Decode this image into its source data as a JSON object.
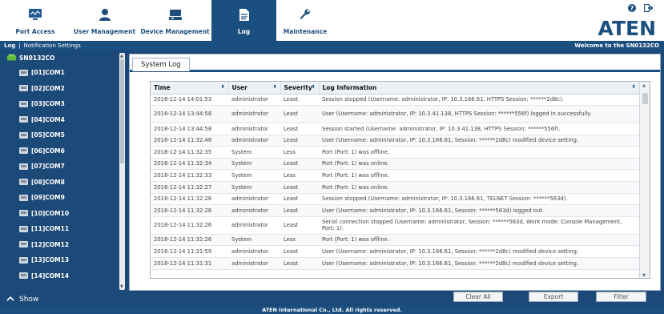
{
  "nav": {
    "tabs": [
      {
        "label": "Port Access",
        "icon": "port-access-icon"
      },
      {
        "label": "User Management",
        "icon": "user-icon"
      },
      {
        "label": "Device Management",
        "icon": "device-icon"
      },
      {
        "label": "Log",
        "icon": "log-icon",
        "active": true
      },
      {
        "label": "Maintenance",
        "icon": "wrench-icon"
      }
    ],
    "logo": "ATEN"
  },
  "subbar": {
    "crumb_log": "Log",
    "separator": "|",
    "crumb_notification": "Notification Settings",
    "welcome": "Welcome to the SN0132CO"
  },
  "sidebar": {
    "root": "SN0132CO",
    "items": [
      "[01]COM1",
      "[02]COM2",
      "[03]COM3",
      "[04]COM4",
      "[05]COM5",
      "[06]COM6",
      "[07]COM7",
      "[08]COM8",
      "[09]COM9",
      "[10]COM10",
      "[11]COM11",
      "[12]COM12",
      "[13]COM13",
      "[14]COM14"
    ],
    "show_label": "Show"
  },
  "main": {
    "tab": "System Log",
    "columns": [
      "Time",
      "User",
      "Severity",
      "Log Information"
    ],
    "rows": [
      {
        "time": "2018-12-14 14:01:53",
        "user": "administrator",
        "severity": "Least",
        "info": "Session stopped (Username: administrator, IP: 10.3.166.61, HTTPS Session: ******2d8c)."
      },
      {
        "time": "2018-12-14 13:44:58",
        "user": "administrator",
        "severity": "Least",
        "info": "User (Username: administrator, IP: 10.3.41.138, HTTPS Session: ******556f) logged in successfully."
      },
      {
        "time": "2018-12-14 13:44:58",
        "user": "administrator",
        "severity": "Least",
        "info": "Session started (Username: administrator, IP: 10.3.41.138, HTTPS Session: ******556f)."
      },
      {
        "time": "2018-12-14 11:32:48",
        "user": "administrator",
        "severity": "Least",
        "info": "User (Username: administrator, IP: 10.3.166.61, Session: ******2d8c) modified device setting."
      },
      {
        "time": "2018-12-14 11:32:35",
        "user": "System",
        "severity": "Less",
        "info": "Port (Port: 1) was offline."
      },
      {
        "time": "2018-12-14 11:32:34",
        "user": "System",
        "severity": "Least",
        "info": "Port (Port: 1) was online."
      },
      {
        "time": "2018-12-14 11:32:33",
        "user": "System",
        "severity": "Less",
        "info": "Port (Port: 1) was offline."
      },
      {
        "time": "2018-12-14 11:32:27",
        "user": "System",
        "severity": "Least",
        "info": "Port (Port: 1) was online."
      },
      {
        "time": "2018-12-14 11:32:26",
        "user": "administrator",
        "severity": "Least",
        "info": "Session stopped (Username: administrator, IP: 10.3.166.61, TELNET Session: ******563d)."
      },
      {
        "time": "2018-12-14 11:32:26",
        "user": "administrator",
        "severity": "Least",
        "info": "User (Username: administrator, IP: 10.3.166.61, Session: ******563d) logged out."
      },
      {
        "time": "2018-12-14 11:32:26",
        "user": "administrator",
        "severity": "Least",
        "info": "Serial connection stopped (Username: administrator, Session: ******563d, Work mode: Console Management, Port: 1)."
      },
      {
        "time": "2018-12-14 11:32:26",
        "user": "System",
        "severity": "Less",
        "info": "Port (Port: 1) was offline."
      },
      {
        "time": "2018-12-14 11:31:59",
        "user": "administrator",
        "severity": "Least",
        "info": "User (Username: administrator, IP: 10.3.166.61, Session: ******2d8c) modified device setting."
      },
      {
        "time": "2018-12-14 11:31:31",
        "user": "administrator",
        "severity": "Least",
        "info": "User (Username: administrator, IP: 10.3.166.61, Session: ******2d8c) modified device setting."
      }
    ],
    "buttons": {
      "clear_all": "Clear All",
      "export": "Export",
      "filter": "Filter"
    }
  },
  "footer": "ATEN International Co., Ltd. All rights reserved.",
  "colors": {
    "brand": "#1b4f80",
    "sidebar": "#1c4a78"
  }
}
